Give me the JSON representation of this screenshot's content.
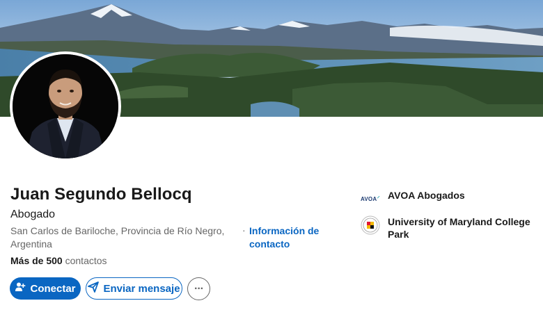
{
  "profile": {
    "name": "Juan Segundo Bellocq",
    "headline": "Abogado",
    "location": "San Carlos de Bariloche, Provincia de Río Negro, Argentina",
    "contact_info_link": "Información de contacto",
    "connections_count": "Más de 500",
    "connections_label": "contactos"
  },
  "actions": {
    "connect": "Conectar",
    "message": "Enviar mensaje",
    "more": "···"
  },
  "organizations": [
    {
      "name": "AVOA Abogados",
      "logo_text": "AVOA",
      "logo_icon": "avoa-logo"
    },
    {
      "name": "University of Maryland College Park",
      "logo_icon": "university-seal"
    }
  ],
  "colors": {
    "primary": "#0a66c2",
    "text": "#191919",
    "secondary_text": "#666666"
  }
}
